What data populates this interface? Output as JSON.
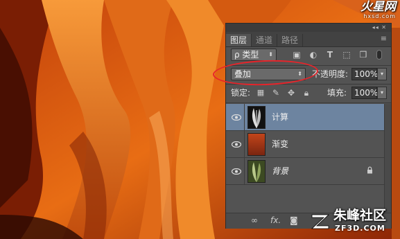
{
  "watermark_top": {
    "brand": "火星网",
    "site": "hxsd.com"
  },
  "panel": {
    "tabs": [
      {
        "label": "图层",
        "active": true
      },
      {
        "label": "通道",
        "active": false
      },
      {
        "label": "路径",
        "active": false
      }
    ],
    "filter": {
      "label": "ρ 类型"
    },
    "blend_mode": {
      "value": "叠加"
    },
    "opacity": {
      "label": "不透明度:",
      "value": "100%"
    },
    "lock": {
      "label": "锁定:"
    },
    "fill": {
      "label": "填充:",
      "value": "100%"
    },
    "layers": [
      {
        "name": "计算",
        "selected": true,
        "italic": false,
        "locked": false
      },
      {
        "name": "渐变",
        "selected": false,
        "italic": false,
        "locked": false
      },
      {
        "name": "背景",
        "selected": false,
        "italic": true,
        "locked": true
      }
    ],
    "bottom_icons": [
      "link-icon",
      "fx-icon",
      "mask-icon"
    ],
    "fx_label": "fx."
  },
  "watermark_bottom": {
    "cn": "朱峰社区",
    "en": "ZF3D.COM"
  },
  "colors": {
    "selection": "#6d84a0",
    "panel": "#535353",
    "highlight_ring": "#e8242a"
  }
}
